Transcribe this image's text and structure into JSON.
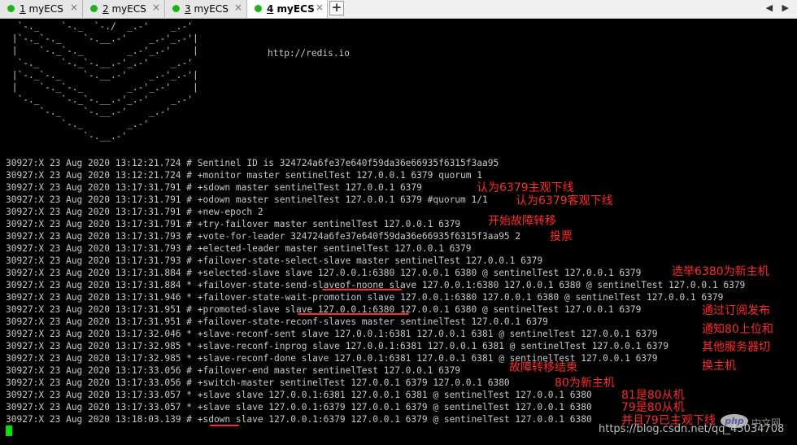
{
  "tabs": [
    {
      "number": "1",
      "name": "myECS",
      "active": false
    },
    {
      "number": "2",
      "name": "myECS",
      "active": false
    },
    {
      "number": "3",
      "name": "myECS",
      "active": false
    },
    {
      "number": "4",
      "name": "myECS",
      "active": true
    }
  ],
  "tab_close_glyph": "×",
  "add_tab_glyph": "+",
  "nav_arrows": "◀ ▶",
  "ascii_art": "  `-._    `-._  `-./  _.-'    _.-'\n |`-._`-._    `-.__.-'    _.-'_.-'|\n |    `-._`-._        _.-'_.-'    |\n  `-._    `-._`-.__.-'_.-'    _.-'\n |`-._`-._    `-.__.-'    _.-'_.-'|\n |    `-._`-._        _.-'_.-'    |\n  `-._    `-._`-.__.-'_.-'    _.-'\n      `-._    `-.__.-'    _.-'\n          `-._        _.-'\n              `-.__.-'",
  "url": "http://redis.io",
  "log_lines": [
    "30927:X 23 Aug 2020 13:12:21.724 # Sentinel ID is 324724a6fe37e640f59da36e66935f6315f3aa95",
    "30927:X 23 Aug 2020 13:12:21.724 # +monitor master sentinelTest 127.0.0.1 6379 quorum 1",
    "30927:X 23 Aug 2020 13:17:31.791 # +sdown master sentinelTest 127.0.0.1 6379",
    "30927:X 23 Aug 2020 13:17:31.791 # +odown master sentinelTest 127.0.0.1 6379 #quorum 1/1",
    "30927:X 23 Aug 2020 13:17:31.791 # +new-epoch 2",
    "30927:X 23 Aug 2020 13:17:31.791 # +try-failover master sentinelTest 127.0.0.1 6379",
    "30927:X 23 Aug 2020 13:17:31.793 # +vote-for-leader 324724a6fe37e640f59da36e66935f6315f3aa95 2",
    "30927:X 23 Aug 2020 13:17:31.793 # +elected-leader master sentinelTest 127.0.0.1 6379",
    "30927:X 23 Aug 2020 13:17:31.793 # +failover-state-select-slave master sentinelTest 127.0.0.1 6379",
    "30927:X 23 Aug 2020 13:17:31.884 # +selected-slave slave 127.0.0.1:6380 127.0.0.1 6380 @ sentinelTest 127.0.0.1 6379",
    "30927:X 23 Aug 2020 13:17:31.884 * +failover-state-send-slaveof-noone slave 127.0.0.1:6380 127.0.0.1 6380 @ sentinelTest 127.0.0.1 6379",
    "30927:X 23 Aug 2020 13:17:31.946 * +failover-state-wait-promotion slave 127.0.0.1:6380 127.0.0.1 6380 @ sentinelTest 127.0.0.1 6379",
    "30927:X 23 Aug 2020 13:17:31.951 # +promoted-slave slave 127.0.0.1:6380 127.0.0.1 6380 @ sentinelTest 127.0.0.1 6379",
    "30927:X 23 Aug 2020 13:17:31.951 # +failover-state-reconf-slaves master sentinelTest 127.0.0.1 6379",
    "30927:X 23 Aug 2020 13:17:32.046 * +slave-reconf-sent slave 127.0.0.1:6381 127.0.0.1 6381 @ sentinelTest 127.0.0.1 6379",
    "30927:X 23 Aug 2020 13:17:32.985 * +slave-reconf-inprog slave 127.0.0.1:6381 127.0.0.1 6381 @ sentinelTest 127.0.0.1 6379",
    "30927:X 23 Aug 2020 13:17:32.985 * +slave-reconf-done slave 127.0.0.1:6381 127.0.0.1 6381 @ sentinelTest 127.0.0.1 6379",
    "30927:X 23 Aug 2020 13:17:33.056 # +failover-end master sentinelTest 127.0.0.1 6379",
    "30927:X 23 Aug 2020 13:17:33.056 # +switch-master sentinelTest 127.0.0.1 6379 127.0.0.1 6380",
    "30927:X 23 Aug 2020 13:17:33.057 * +slave slave 127.0.0.1:6381 127.0.0.1 6381 @ sentinelTest 127.0.0.1 6380",
    "30927:X 23 Aug 2020 13:17:33.057 * +slave slave 127.0.0.1:6379 127.0.0.1 6379 @ sentinelTest 127.0.0.1 6380",
    "30927:X 23 Aug 2020 13:18:03.139 # +sdown slave 127.0.0.1:6379 127.0.0.1 6379 @ sentinelTest 127.0.0.1 6380"
  ],
  "annotations": [
    "认为6379主观下线",
    "认为6379客观下线",
    "开始故障转移",
    "投票",
    "选举6380为新主机",
    "通过订阅发布",
    "通知80上位和",
    "其他服务器切",
    "换主机",
    "故障转移结束",
    "80为新主机",
    "81是80从机",
    "79是80从机",
    "并且79已主观下线"
  ],
  "watermark": {
    "logo": "php",
    "text": "中文网"
  },
  "csdn_url": "https://blog.csdn.net/qq_45034708",
  "colors": {
    "terminal_bg": "#000000",
    "terminal_fg": "#c8c8c8",
    "annotation": "#ff2a2a",
    "cursor": "#00e100",
    "tab_dot": "#1bb51b"
  }
}
